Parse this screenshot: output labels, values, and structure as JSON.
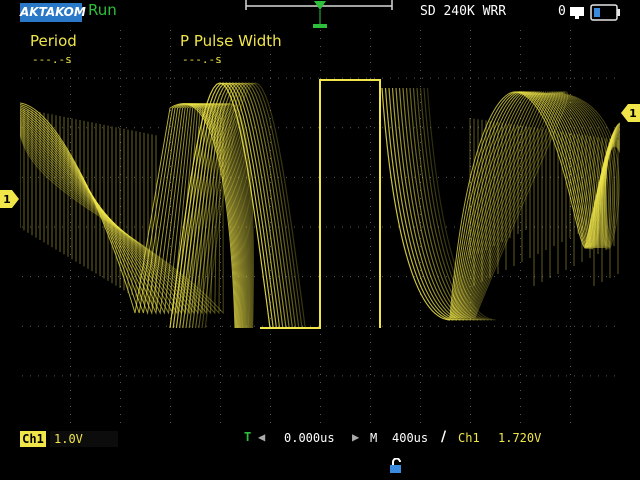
{
  "status": {
    "brand": "AKTAKOM",
    "run_state": "Run",
    "memory": "SD 240K WRR",
    "count": "0"
  },
  "measurements": [
    {
      "label": "Period",
      "value": "---.-s"
    },
    {
      "label": "P Pulse Width",
      "value": "---.-s"
    }
  ],
  "channel": {
    "badge": "Ch1",
    "scale": "1.0V",
    "marker": "1"
  },
  "timebase": {
    "trigger_icon": "T",
    "position": "0.000us",
    "mode_label": "M",
    "scale": "400us"
  },
  "trigger": {
    "source": "Ch1",
    "level": "1.720V"
  },
  "colors": {
    "trace": "#f0e64a",
    "run": "#2ec03a",
    "brand_bg": "#2a78c8",
    "grid": "#5a5a5a"
  },
  "icons": [
    "usb-icon",
    "battery-icon",
    "lock-open-icon",
    "trigger-marker-icon",
    "channel-marker-icon",
    "rising-edge-icon"
  ]
}
